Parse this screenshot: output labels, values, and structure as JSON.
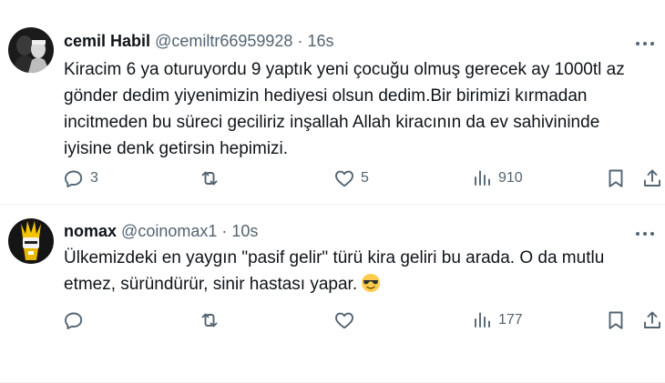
{
  "tweets": [
    {
      "name": "cemil Habil",
      "handle": "@cemiltr66959928",
      "separator": "·",
      "time": "16s",
      "text_lines": [
        "Kiracim 6 ya oturuyordu 9 yaptık yeni çocuğu olmuş gerecek ay 1000tl az",
        "gönder dedim yiyenimizin hediyesi olsun dedim.Bir birimizi kırmadan",
        "incitmeden bu süreci geciliriz inşallah Allah kiracının da ev sahivininde",
        "iyisine denk getirsin hepimizi."
      ],
      "replies": "3",
      "retweets": "",
      "likes": "5",
      "views": "910"
    },
    {
      "name": "nomax",
      "handle": "@coinomax1",
      "separator": "·",
      "time": "10s",
      "text_lines": [
        "Ülkemizdeki en yaygın \"pasif gelir\" türü kira geliri bu arada. O da mutlu",
        "etmez, süründürür, sinir hastası yapar."
      ],
      "emoji": "smiling-face-with-sunglasses",
      "replies": "",
      "retweets": "",
      "likes": "",
      "views": "177"
    }
  ],
  "icons": {
    "reply": "reply-icon",
    "retweet": "retweet-icon",
    "like": "like-icon",
    "views": "views-icon",
    "bookmark": "bookmark-icon",
    "share": "share-icon",
    "more": "more-icon"
  },
  "colors": {
    "text": "#0f1419",
    "secondary": "#536471",
    "divider": "#eff3f4",
    "emoji_yellow": "#ffcc4d"
  }
}
